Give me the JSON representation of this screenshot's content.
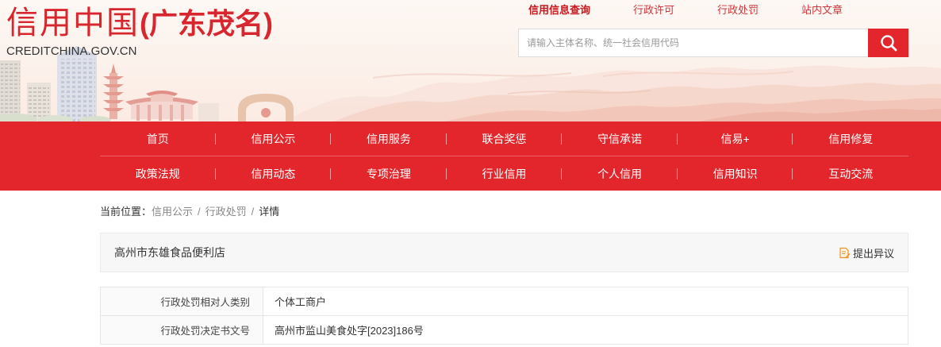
{
  "header": {
    "logo": {
      "main": "信用中国",
      "region": "(广东茂名)",
      "domain": "CREDITCHINA.GOV.CN"
    },
    "top_links": [
      {
        "label": "信用信息查询",
        "active": true
      },
      {
        "label": "行政许可",
        "active": false
      },
      {
        "label": "行政处罚",
        "active": false
      },
      {
        "label": "站内文章",
        "active": false
      }
    ],
    "search": {
      "placeholder": "请输入主体名称、统一社会信用代码"
    }
  },
  "nav": {
    "rows": [
      [
        "首页",
        "信用公示",
        "信用服务",
        "联合奖惩",
        "守信承诺",
        "信易+",
        "信用修复"
      ],
      [
        "政策法规",
        "信用动态",
        "专项治理",
        "行业信用",
        "个人信用",
        "信用知识",
        "互动交流"
      ]
    ]
  },
  "breadcrumb": {
    "prefix": "当前位置：",
    "separator": "/",
    "items": [
      "信用公示",
      "行政处罚",
      "详情"
    ]
  },
  "record": {
    "title": "高州市东雄食品便利店",
    "objection_label": "提出异议",
    "fields": [
      {
        "label": "行政处罚相对人类别",
        "value": "个体工商户"
      },
      {
        "label": "行政处罚决定书文号",
        "value": "高州市监山美食处字[2023]186号"
      }
    ]
  },
  "icons": {
    "search_button": "search-icon",
    "objection": "document-edit-icon"
  },
  "colors": {
    "nav_background": "#e3262b",
    "logo_text": "#d7262d",
    "active_top_link": "#c8161d"
  }
}
